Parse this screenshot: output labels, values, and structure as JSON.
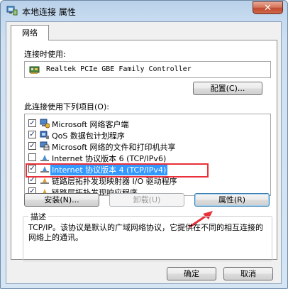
{
  "window": {
    "title": "本地连接 属性",
    "close_label": "✕",
    "icon": "network-adapter-icon"
  },
  "tabs": [
    {
      "label": "网络"
    }
  ],
  "connect_using_label": "连接时使用:",
  "adapter_name": "Realtek PCIe GBE Family Controller",
  "configure_button": "配置(C)...",
  "items_label": "此连接使用下列项目(O):",
  "items": [
    {
      "label": "Microsoft 网络客户端",
      "checked": true,
      "icon": "client-network-icon"
    },
    {
      "label": "QoS 数据包计划程序",
      "checked": true,
      "icon": "qos-scheduler-icon"
    },
    {
      "label": "Microsoft 网络的文件和打印机共享",
      "checked": true,
      "icon": "file-printer-sharing-icon"
    },
    {
      "label": "Internet 协议版本 6 (TCP/IPv6)",
      "checked": false,
      "icon": "protocol-icon"
    },
    {
      "label": "Internet 协议版本 4 (TCP/IPv4)",
      "checked": true,
      "icon": "protocol-icon",
      "selected": true
    },
    {
      "label": "链路层拓扑发现映射器 I/O 驱动程序",
      "checked": true,
      "icon": "protocol-icon"
    },
    {
      "label": "链路层拓扑发现响应程序",
      "checked": true,
      "icon": "protocol-icon"
    }
  ],
  "install_button": "安装(N)...",
  "uninstall_button": "卸载(U)",
  "properties_button": "属性(R)",
  "description_legend": "描述",
  "description_text": "TCP/IP。该协议是默认的广域网络协议，它提供在不同的相互连接的网络上的通讯。",
  "ok_button": "确定",
  "cancel_button": "取消",
  "colors": {
    "annotation_red": "#e8313a",
    "selection_blue": "#3399ff"
  }
}
